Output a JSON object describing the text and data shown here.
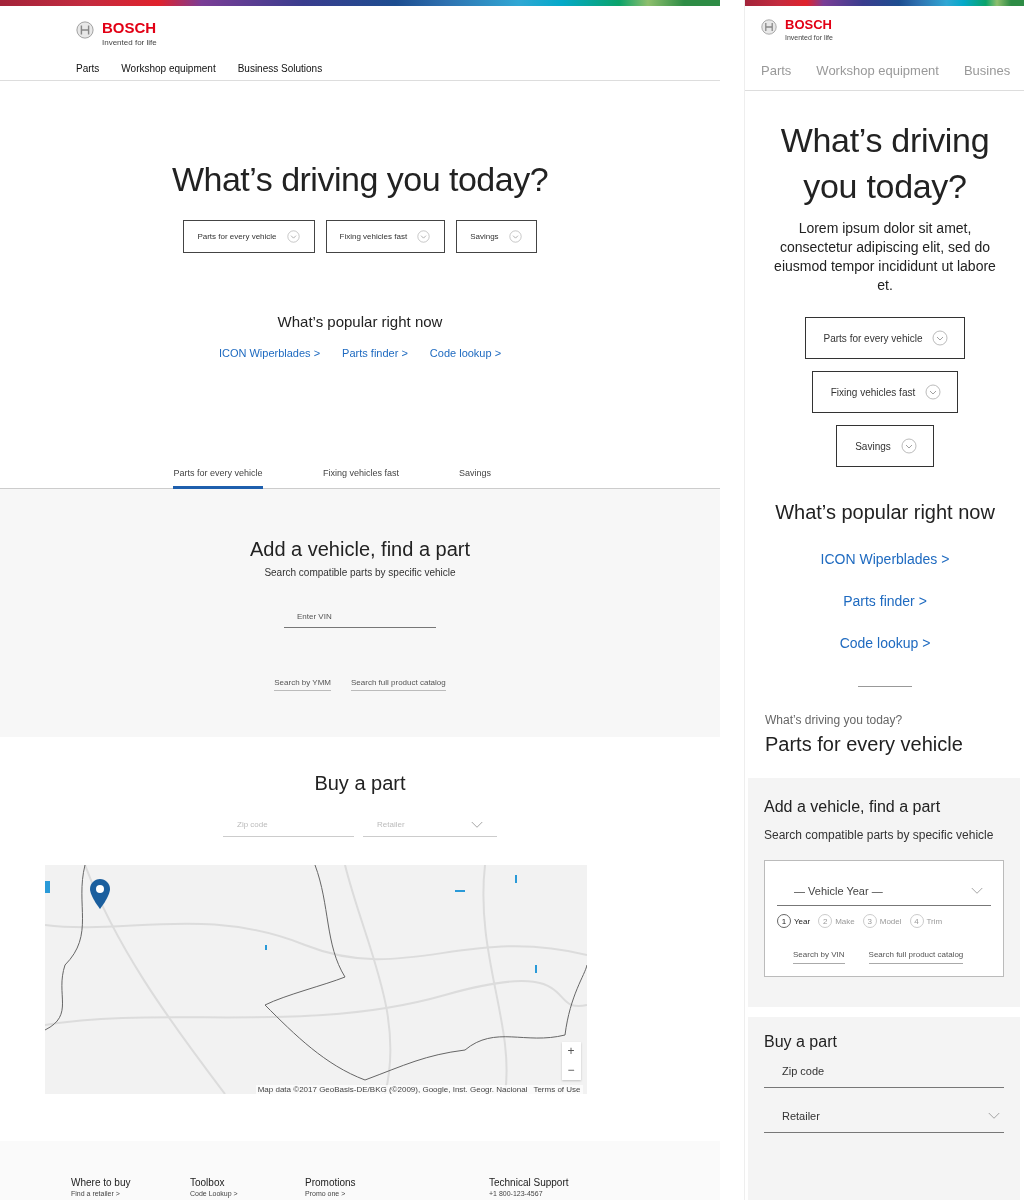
{
  "desktop": {
    "brand": {
      "name": "BOSCH",
      "tagline": "Invented for life"
    },
    "nav": [
      "Parts",
      "Workshop equipment",
      "Business Solutions"
    ],
    "hero": {
      "title": "What’s driving you today?",
      "topics": [
        "Parts for every vehicle",
        "Fixing vehicles fast",
        "Savings"
      ]
    },
    "popular": {
      "title": "What’s popular right now",
      "links": [
        "ICON Wiperblades >",
        "Parts finder >",
        "Code lookup >"
      ]
    },
    "tabs": [
      {
        "label": "Parts for every vehicle",
        "selected": true
      },
      {
        "label": "Fixing vehicles fast",
        "selected": false
      },
      {
        "label": "Savings",
        "selected": false
      }
    ],
    "vehicle_search": {
      "title": "Add a vehicle, find a part",
      "subtitle": "Search compatible parts by specific vehicle",
      "vin": {
        "placeholder": "Enter VIN"
      },
      "links": [
        "Search by YMM",
        "Search full product catalog"
      ]
    },
    "buy": {
      "title": "Buy a part",
      "zip": {
        "placeholder": "Zip code"
      },
      "retailer": {
        "placeholder": "Retailer"
      },
      "map": {
        "kind": "picture",
        "zoom_in": "+",
        "zoom_out": "−",
        "attribution": "Map data ©2017 GeoBasis-DE/BKG (©2009), Google, Inst. Geogr. Nacional",
        "terms": "Terms of Use"
      }
    },
    "footer": [
      {
        "heading": "Where to buy",
        "link": "Find a retailer >"
      },
      {
        "heading": "Toolbox",
        "link": "Code Lookup >"
      },
      {
        "heading": "Promotions",
        "link": "Promo one >"
      },
      {
        "heading": "Technical Support",
        "link": "+1 800-123-4567"
      }
    ]
  },
  "mobile": {
    "brand": {
      "name": "BOSCH",
      "tagline": "Invented for life"
    },
    "nav": [
      "Parts",
      "Workshop equipment",
      "Busines"
    ],
    "hero": {
      "title": "What’s driving you today?",
      "text": "Lorem ipsum dolor sit amet, consectetur adipiscing elit, sed do eiusmod tempor incididunt ut labore et.",
      "topics": [
        "Parts for every vehicle",
        "Fixing vehicles fast",
        "Savings"
      ]
    },
    "popular": {
      "title": "What’s popular right now",
      "links": [
        "ICON Wiperblades >",
        "Parts finder >",
        "Code lookup >"
      ]
    },
    "section": {
      "eyebrow": "What’s driving you today?",
      "title": "Parts for every vehicle"
    },
    "vehicle_search": {
      "title": "Add a vehicle, find a part",
      "subtitle": "Search compatible parts by specific vehicle",
      "year_select": {
        "placeholder": "— Vehicle Year —"
      },
      "steps": [
        {
          "number": "1",
          "label": "Year",
          "selected": true
        },
        {
          "number": "2",
          "label": "Make",
          "selected": false
        },
        {
          "number": "3",
          "label": "Model",
          "selected": false
        },
        {
          "number": "4",
          "label": "Trim",
          "selected": false
        }
      ],
      "links": [
        "Search by VIN",
        "Search full product catalog"
      ]
    },
    "buy": {
      "title": "Buy a part",
      "zip": {
        "placeholder": "Zip code"
      },
      "retailer": {
        "placeholder": "Retailer"
      }
    }
  }
}
